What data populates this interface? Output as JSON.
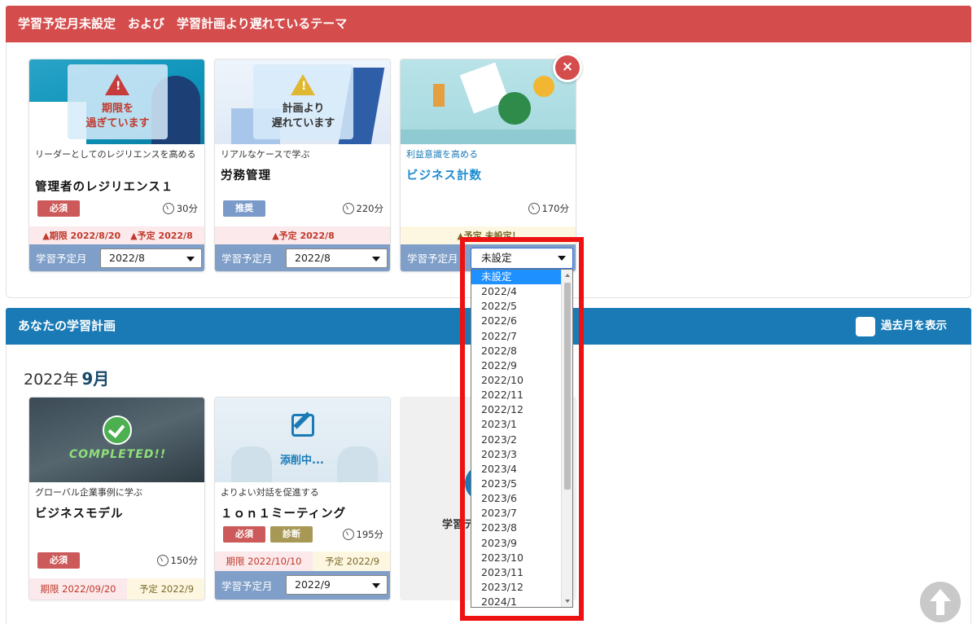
{
  "overdue_section": {
    "title": "学習予定月未設定　および　学習計画より遅れているテーマ",
    "cards": [
      {
        "overlay": "期限を\n過ぎています",
        "subtitle": "リーダーとしてのレジリエンスを高める",
        "title": "管理者のレジリエンス１",
        "badge": "必須",
        "duration": "30分",
        "status_deadline": "▲期限 2022/8/20",
        "status_plan": "▲予定 2022/8",
        "plan_label": "学習予定月",
        "plan_value": "2022/8"
      },
      {
        "overlay": "計画より\n遅れています",
        "subtitle": "リアルなケースで学ぶ",
        "title": "労務管理",
        "badge": "推奨",
        "duration": "220分",
        "status_plan": "▲予定 2022/8",
        "plan_label": "学習予定月",
        "plan_value": "2022/8"
      },
      {
        "subtitle": "利益意識を高める",
        "title": "ビジネス計数",
        "duration": "170分",
        "status_plan": "▲予定 未設定！",
        "plan_label": "学習予定月",
        "plan_value": "未設定"
      }
    ],
    "close_label": "×"
  },
  "plan_section": {
    "title": "あなたの学習計画",
    "past_months_label": "過去月を表示",
    "year": "2022年",
    "month": "9月",
    "cards": [
      {
        "overlay": "COMPLETED!!",
        "subtitle": "グローバル企業事例に学ぶ",
        "title": "ビジネスモデル",
        "badge": "必須",
        "duration": "150分",
        "deadline_label": "期限",
        "deadline": "2022/09/20",
        "plan_label": "予定",
        "plan": "2022/9"
      },
      {
        "overlay": "添削中...",
        "subtitle": "よりよい対話を促進する",
        "title": "１ｏｎ１ミーティング",
        "badge": "必須",
        "badge2": "診断",
        "duration": "195分",
        "deadline_label": "期限",
        "deadline": "2022/10/10",
        "plan_label": "予定",
        "plan": "2022/9",
        "select_label": "学習予定月",
        "select_value": "2022/9"
      }
    ],
    "add_text": "学習テ"
  },
  "dropdown": {
    "current": "未設定",
    "options": [
      "未設定",
      "2022/4",
      "2022/5",
      "2022/6",
      "2022/7",
      "2022/8",
      "2022/9",
      "2022/10",
      "2022/11",
      "2022/12",
      "2023/1",
      "2023/2",
      "2023/3",
      "2023/4",
      "2023/5",
      "2023/6",
      "2023/7",
      "2023/8",
      "2023/9",
      "2023/10",
      "2023/11",
      "2023/12",
      "2024/1"
    ]
  },
  "colors": {
    "overdue_header": "#d44c4c",
    "plan_header": "#1a7ab6",
    "select_row": "#7f9fc9",
    "highlight": "#ee1111"
  }
}
